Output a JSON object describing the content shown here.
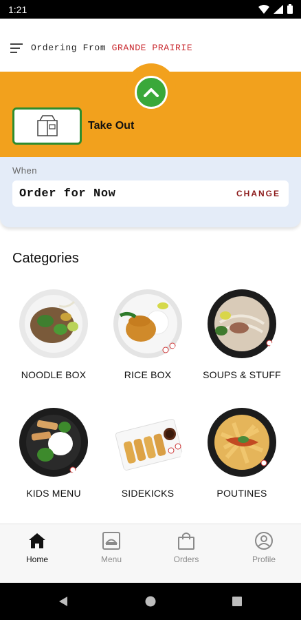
{
  "status_bar": {
    "time": "1:21",
    "icons": [
      "wifi-icon",
      "signal-icon",
      "battery-icon"
    ]
  },
  "header": {
    "ordering_prefix": "Ordering From",
    "location": "GRANDE PRAIRIE"
  },
  "order_type": {
    "label": "Take Out"
  },
  "when": {
    "label": "When",
    "value": "Order for Now",
    "change_label": "CHANGE"
  },
  "categories": {
    "title": "Categories",
    "items": [
      {
        "label": "NOODLE BOX"
      },
      {
        "label": "RICE BOX"
      },
      {
        "label": "SOUPS & STUFF"
      },
      {
        "label": "KIDS MENU"
      },
      {
        "label": "SIDEKICKS"
      },
      {
        "label": "POUTINES"
      }
    ]
  },
  "bottom_nav": {
    "items": [
      {
        "label": "Home",
        "icon": "home-icon",
        "active": true
      },
      {
        "label": "Menu",
        "icon": "menu-tray-icon"
      },
      {
        "label": "Orders",
        "icon": "shopping-bag-icon"
      },
      {
        "label": "Profile",
        "icon": "profile-icon"
      }
    ]
  },
  "colors": {
    "accent_orange": "#f2a11d",
    "accent_green": "#3aa83a",
    "location_red": "#c8262c",
    "change_red": "#8c1a1a",
    "when_bg": "#e4ecf8"
  }
}
